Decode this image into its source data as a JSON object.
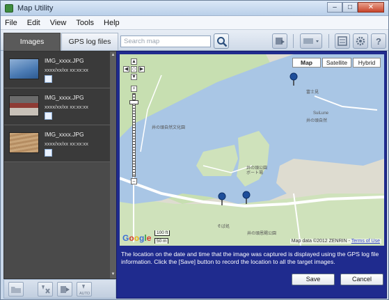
{
  "window": {
    "title": "Map Utility"
  },
  "menu": [
    "File",
    "Edit",
    "View",
    "Tools",
    "Help"
  ],
  "tabs": {
    "images": "Images",
    "gps_log": "GPS log files"
  },
  "search": {
    "placeholder": "Search map"
  },
  "images": [
    {
      "name": "IMG_xxxx.JPG",
      "datetime": "xxxx/xx/xx xx:xx:xx"
    },
    {
      "name": "IMG_xxxx.JPG",
      "datetime": "xxxx/xx/xx xx:xx:xx"
    },
    {
      "name": "IMG_xxxx.JPG",
      "datetime": "xxxx/xx/xx xx:xx:xx"
    }
  ],
  "map": {
    "types": [
      "Map",
      "Satellite",
      "Hybrid"
    ],
    "selected_type": "Map",
    "credit": "Map data ©2012 ZENRIN - ",
    "terms": "Terms of Use",
    "scale_ft": "100 ft",
    "scale_m": "50 m",
    "labels": [
      "井の頭自然文化園",
      "富士見",
      "井の頭公園",
      "ボート場",
      "そば処",
      "井の頭恩賜公園",
      "SuiLune",
      "井の頭自然"
    ]
  },
  "info_text": "The location on the date and time that the image was captured is displayed using the GPS log file information. Click the [Save] button to record the location to all the target images.",
  "buttons": {
    "save": "Save",
    "cancel": "Cancel"
  },
  "icons": [
    "app-icon",
    "search-icon",
    "gps-marker-icon",
    "map-pin-icon",
    "folder-icon",
    "settings-icon",
    "help-icon"
  ]
}
